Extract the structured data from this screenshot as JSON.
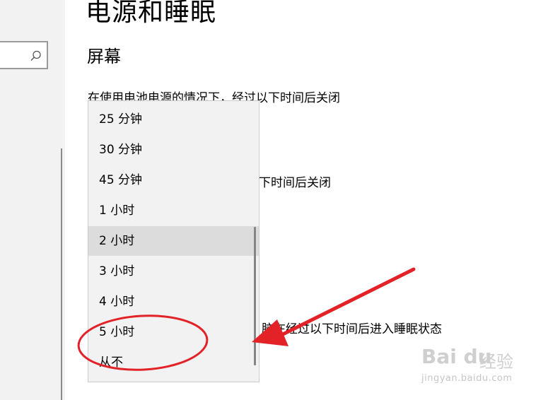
{
  "page": {
    "title": "电源和睡眠",
    "section_title": "屏幕",
    "battery_screen_label": "在使用电池电源的情况下，经过以下时间后关闭",
    "plugged_screen_label_partial": "下时间后关闭",
    "sleep_label_partial": "脑在经过以下时间后进入睡眠状态"
  },
  "search": {
    "value": ""
  },
  "dropdown": {
    "options": [
      "25 分钟",
      "30 分钟",
      "45 分钟",
      "1 小时",
      "2 小时",
      "3 小时",
      "4 小时",
      "5 小时",
      "从不"
    ],
    "selected": "2 小时"
  },
  "annotation": {
    "color": "#e32228"
  },
  "watermark": {
    "logo": "Bai du",
    "brand": "经验",
    "url": "jingyan.baidu.com"
  }
}
